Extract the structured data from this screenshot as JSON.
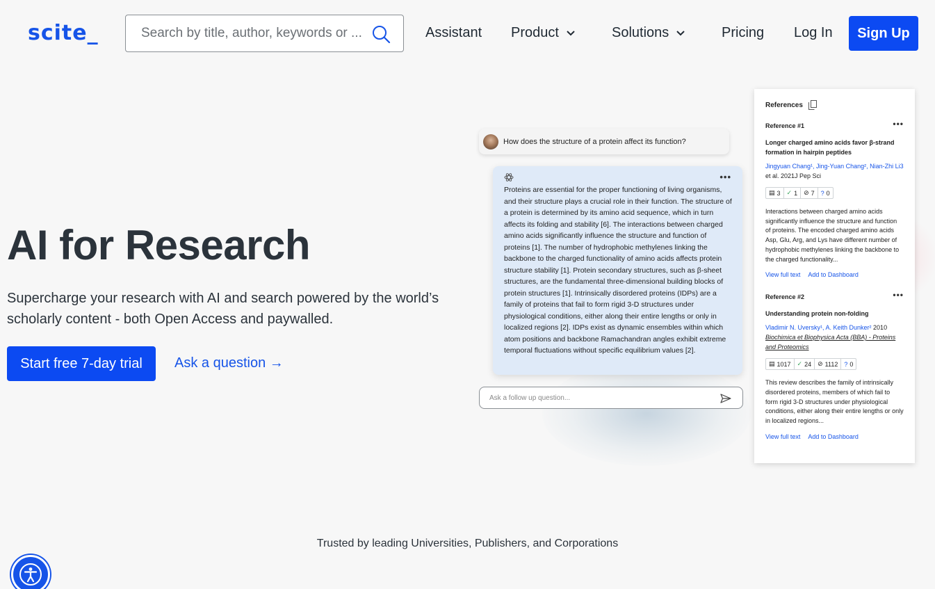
{
  "header": {
    "logo": "scite_",
    "search_placeholder": "Search by title, author, keywords or ...",
    "nav": {
      "assistant": "Assistant",
      "product": "Product",
      "solutions": "Solutions",
      "pricing": "Pricing",
      "login": "Log In",
      "signup": "Sign Up"
    }
  },
  "hero": {
    "title": "AI for Research",
    "subtitle": "Supercharge your research with AI and search powered by the world’s scholarly content - both Open Access and paywalled.",
    "cta_primary": "Start free 7-day trial",
    "cta_secondary": "Ask a question →"
  },
  "assistant": {
    "question": "How does the structure of a protein affect its function?",
    "answer": "Proteins are essential for the proper functioning of living organisms, and their structure plays a crucial role in their function. The structure of a protein is determined by its amino acid sequence, which in turn affects its folding and stability [6]. The interactions between charged amino acids significantly influence the structure and function of proteins [1]. The number of hydrophobic methylenes linking the backbone to the charged functionality of amino acids affects protein structure stability [1]. Protein secondary structures, such as β-sheet structures, are the fundamental three-dimensional building blocks of protein structures [1]. Intrinsically disordered proteins (IDPs) are a family of proteins that fail to form rigid 3-D structures under physiological conditions, either along their entire lengths or only in localized regions [2]. IDPs exist as dynamic ensembles within which atom positions and backbone Ramachandran angles exhibit extreme temporal fluctuations without specific equilibrium values [2].",
    "followup_placeholder": "Ask a follow up question..."
  },
  "references": {
    "heading": "References",
    "items": [
      {
        "label": "Reference #1",
        "title": "Longer charged amino acids favor β-strand formation in hairpin peptides",
        "authors_linked": "Jingyuan Chang¹, Jing-Yuan Chang², Nian-Zhi Li3",
        "authors_rest": " et al. 2021J Pep Sci",
        "journal": "",
        "stats": {
          "citing": "3",
          "supporting": "1",
          "mentioning": "7",
          "contrasting": "0"
        },
        "abstract": "Interactions between charged amino acids significantly influence the structure and function of proteins. The encoded charged amino acids Asp, Glu, Arg, and Lys have different number of hydrophobic methylenes linking the backbone to the charged functionality...",
        "view_full_text": "View full text",
        "add_to_dashboard": "Add to Dashboard"
      },
      {
        "label": "Reference #2",
        "title": "Understanding protein non-folding",
        "authors_linked": "Vladimir N. Uversky¹, A. Keith Dunker²",
        "authors_rest": " 2010",
        "journal": "Biochimica et Biophysica Acta (BBA) - Proteins and Proteomics",
        "stats": {
          "citing": "1017",
          "supporting": "24",
          "mentioning": "1112",
          "contrasting": "0"
        },
        "abstract": "This review describes the family of intrinsically disordered proteins, members of which fail to form rigid 3-D structures under physiological conditions, either along their entire lengths or only in localized regions...",
        "view_full_text": "View full text",
        "add_to_dashboard": "Add to Dashboard"
      }
    ]
  },
  "trusted": "Trusted by leading Universities, Publishers, and Corporations",
  "colors": {
    "brand": "#1654e8",
    "button": "#0c4af2",
    "answer_bg": "#dfeaf8"
  }
}
